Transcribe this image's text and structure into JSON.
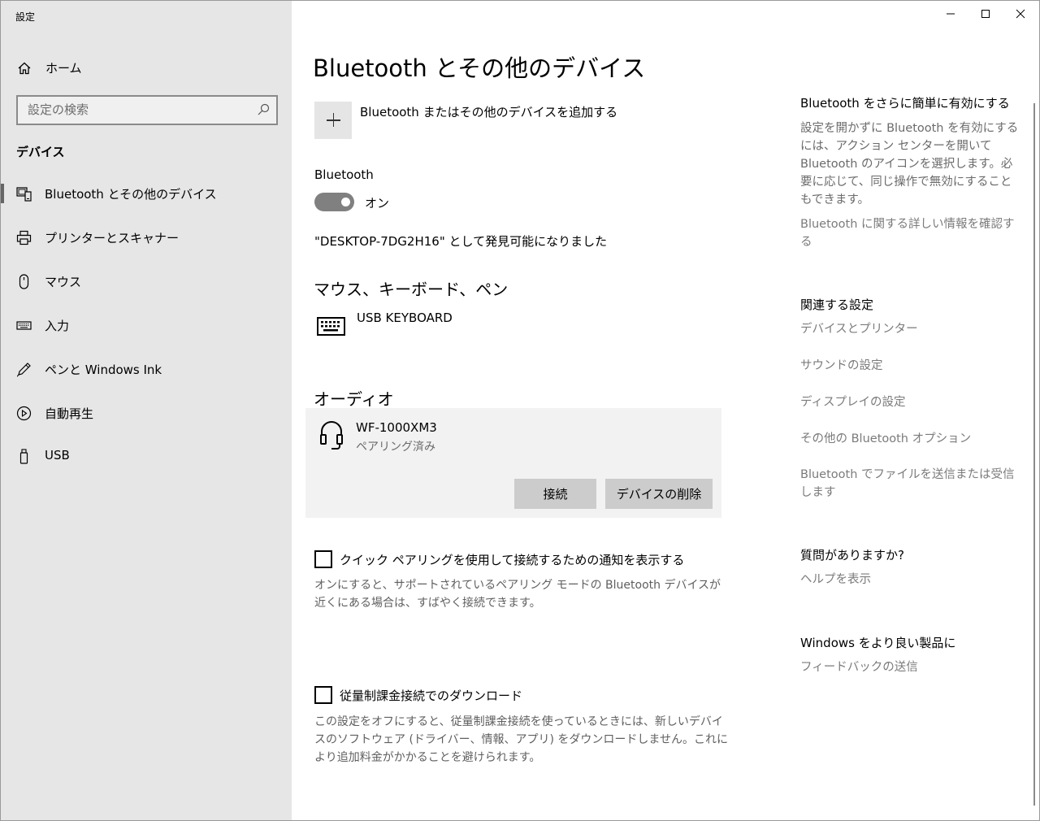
{
  "window": {
    "app_title": "設定",
    "controls": {
      "minimize": "─",
      "maximize": "☐",
      "close": "✕"
    }
  },
  "sidebar": {
    "home_label": "ホーム",
    "search_placeholder": "設定の検索",
    "section_title": "デバイス",
    "items": [
      {
        "label": "Bluetooth とその他のデバイス",
        "icon": "bluetooth-devices-icon",
        "active": true
      },
      {
        "label": "プリンターとスキャナー",
        "icon": "printer-icon",
        "active": false
      },
      {
        "label": "マウス",
        "icon": "mouse-icon",
        "active": false
      },
      {
        "label": "入力",
        "icon": "keyboard-icon",
        "active": false
      },
      {
        "label": "ペンと Windows Ink",
        "icon": "pen-icon",
        "active": false
      },
      {
        "label": "自動再生",
        "icon": "autoplay-icon",
        "active": false
      },
      {
        "label": "USB",
        "icon": "usb-icon",
        "active": false
      }
    ]
  },
  "main": {
    "title": "Bluetooth とその他のデバイス",
    "add_device_label": "Bluetooth またはその他のデバイスを追加する",
    "bluetooth": {
      "label": "Bluetooth",
      "toggle_state": "オン",
      "discoverable_text": "\"DESKTOP-7DG2H16\" として発見可能になりました"
    },
    "input_section": {
      "title": "マウス、キーボード、ペン",
      "devices": [
        {
          "name": "USB KEYBOARD",
          "icon": "keyboard-icon"
        }
      ]
    },
    "audio_section": {
      "title": "オーディオ",
      "device": {
        "name": "WF-1000XM3",
        "status": "ペアリング済み",
        "icon": "headset-icon",
        "connect_label": "接続",
        "remove_label": "デバイスの削除"
      }
    },
    "quick_pairing": {
      "label": "クイック ペアリングを使用して接続するための通知を表示する",
      "checked": false,
      "description": "オンにすると、サポートされているペアリング モードの Bluetooth デバイスが近くにある場合は、すばやく接続できます。"
    },
    "metered": {
      "label": "従量制課金接続でのダウンロード",
      "checked": false,
      "description": "この設定をオフにすると、従量制課金接続を使っているときには、新しいデバイスのソフトウェア (ドライバー、情報、アプリ) をダウンロードしません。これにより追加料金がかかることを避けられます。"
    }
  },
  "right_panel": {
    "easy_title": "Bluetooth をさらに簡単に有効にする",
    "easy_text": "設定を開かずに Bluetooth を有効にするには、アクション センターを開いて Bluetooth のアイコンを選択します。必要に応じて、同じ操作で無効にすることもできます。",
    "easy_link": "Bluetooth に関する詳しい情報を確認する",
    "related_title": "関連する設定",
    "related_links": [
      "デバイスとプリンター",
      "サウンドの設定",
      "ディスプレイの設定",
      "その他の Bluetooth オプション",
      "Bluetooth でファイルを送信または受信します"
    ],
    "question_title": "質問がありますか?",
    "help_link": "ヘルプを表示",
    "feedback_title": "Windows をより良い製品に",
    "feedback_link": "フィードバックの送信"
  },
  "colors": {
    "sidebar_bg": "#e6e6e6",
    "toggle_on": "#808080",
    "card_bg": "#f2f2f2",
    "button_bg": "#cccccc",
    "muted_text": "#6b6b6b"
  }
}
